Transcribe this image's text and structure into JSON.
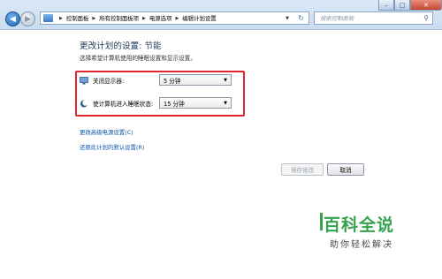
{
  "window": {
    "min_label": "–",
    "max_label": "□",
    "close_label": "✕"
  },
  "address": {
    "crumbs": [
      "控制面板",
      "所有控制面板项",
      "电源选项",
      "编辑计划设置"
    ]
  },
  "search": {
    "placeholder": "搜索控制面板"
  },
  "page": {
    "title": "更改计划的设置: 节能",
    "description": "选择希望计算机使用的睡眠设置和显示设置。"
  },
  "settings": {
    "display_off": {
      "label": "关闭显示器:",
      "value": "5 分钟"
    },
    "sleep": {
      "label": "使计算机进入睡眠状态:",
      "value": "15 分钟"
    }
  },
  "links": {
    "advanced": "更改高级电源设置(C)",
    "restore": "还原此计划的默认设置(R)"
  },
  "buttons": {
    "save": "保存修改",
    "cancel": "取消"
  },
  "watermark": {
    "title": "百科全说",
    "subtitle": "助你轻松解决"
  },
  "colors": {
    "highlight_box": "#e0262d",
    "link": "#0b56b0",
    "watermark": "#35a34e"
  }
}
